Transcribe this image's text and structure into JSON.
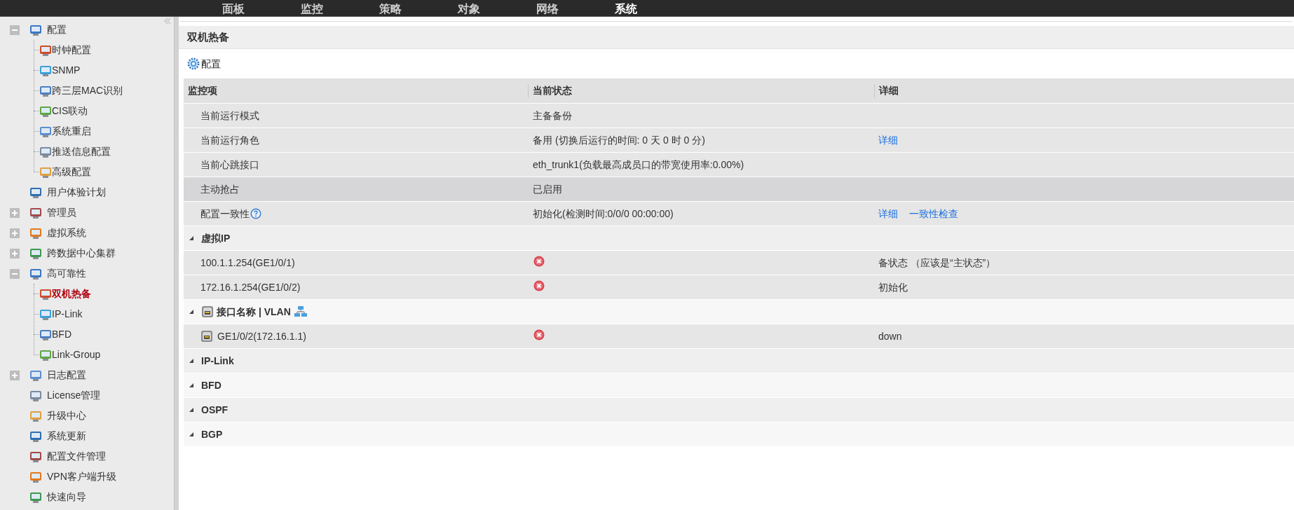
{
  "nav": {
    "tabs": [
      {
        "label": "面板",
        "selected": false
      },
      {
        "label": "监控",
        "selected": false
      },
      {
        "label": "策略",
        "selected": false
      },
      {
        "label": "对象",
        "selected": false
      },
      {
        "label": "网络",
        "selected": false
      },
      {
        "label": "系统",
        "selected": true
      }
    ]
  },
  "sidebar": {
    "items": [
      {
        "label": "配置",
        "kind": "group",
        "expanded": true,
        "selected": false,
        "children": [
          {
            "label": "时钟配置",
            "kind": "leaf",
            "selected": false
          },
          {
            "label": "SNMP",
            "kind": "leaf",
            "selected": false
          },
          {
            "label": "跨三层MAC识别",
            "kind": "leaf",
            "selected": false
          },
          {
            "label": "CIS联动",
            "kind": "leaf",
            "selected": false
          },
          {
            "label": "系统重启",
            "kind": "leaf",
            "selected": false
          },
          {
            "label": "推送信息配置",
            "kind": "leaf",
            "selected": false
          },
          {
            "label": "高级配置",
            "kind": "leaf",
            "selected": false
          }
        ]
      },
      {
        "label": "用户体验计划",
        "kind": "leaf",
        "selected": false
      },
      {
        "label": "管理员",
        "kind": "group",
        "expanded": false,
        "selected": false
      },
      {
        "label": "虚拟系统",
        "kind": "group",
        "expanded": false,
        "selected": false
      },
      {
        "label": "跨数据中心集群",
        "kind": "group",
        "expanded": false,
        "selected": false
      },
      {
        "label": "高可靠性",
        "kind": "group",
        "expanded": true,
        "selected": false,
        "children": [
          {
            "label": "双机热备",
            "kind": "leaf",
            "selected": true
          },
          {
            "label": "IP-Link",
            "kind": "leaf",
            "selected": false
          },
          {
            "label": "BFD",
            "kind": "leaf",
            "selected": false
          },
          {
            "label": "Link-Group",
            "kind": "leaf",
            "selected": false
          }
        ]
      },
      {
        "label": "日志配置",
        "kind": "group",
        "expanded": false,
        "selected": false
      },
      {
        "label": "License管理",
        "kind": "leaf",
        "selected": false
      },
      {
        "label": "升级中心",
        "kind": "leaf",
        "selected": false
      },
      {
        "label": "系统更新",
        "kind": "leaf",
        "selected": false
      },
      {
        "label": "配置文件管理",
        "kind": "leaf",
        "selected": false
      },
      {
        "label": "VPN客户端升级",
        "kind": "leaf",
        "selected": false
      },
      {
        "label": "快速向导",
        "kind": "leaf",
        "selected": false
      }
    ]
  },
  "panel": {
    "title": "双机热备",
    "config_button": "配置"
  },
  "table": {
    "columns": [
      "监控项",
      "当前状态",
      "详细"
    ],
    "rows": [
      {
        "kind": "field",
        "label": "当前运行模式",
        "status": "主备备份",
        "highlighted": false
      },
      {
        "kind": "field",
        "label": "当前运行角色",
        "status": "备用 (切换后运行的时间: 0 天 0 时 0 分)",
        "links": [
          "详细"
        ],
        "highlighted": false
      },
      {
        "kind": "field",
        "label": "当前心跳接口",
        "status": "eth_trunk1(负载最高成员口的带宽使用率:0.00%)",
        "highlighted": false
      },
      {
        "kind": "field",
        "label": "主动抢占",
        "status": "已启用",
        "highlighted": true
      },
      {
        "kind": "field",
        "label": "配置一致性",
        "help": true,
        "status": "初始化(检测时间:0/0/0 00:00:00)",
        "links": [
          "详细",
          "一致性检查"
        ],
        "highlighted": false
      },
      {
        "kind": "section",
        "label": "虚拟IP",
        "expanded": true
      },
      {
        "kind": "member",
        "label": "100.1.1.254(GE1/0/1)",
        "failed": true,
        "detail": "备状态 （应该是“主状态”）"
      },
      {
        "kind": "member",
        "label": "172.16.1.254(GE1/0/2)",
        "failed": true,
        "detail": "初始化"
      },
      {
        "kind": "section",
        "label": "接口名称 | VLAN",
        "port": true,
        "expanded": true
      },
      {
        "kind": "member",
        "label": "GE1/0/2(172.16.1.1)",
        "port": true,
        "failed": true,
        "detail": "down"
      },
      {
        "kind": "section",
        "label": "IP-Link",
        "expanded": true
      },
      {
        "kind": "section",
        "label": "BFD",
        "expanded": true
      },
      {
        "kind": "section",
        "label": "OSPF",
        "expanded": true
      },
      {
        "kind": "section",
        "label": "BGP",
        "expanded": true
      }
    ]
  }
}
